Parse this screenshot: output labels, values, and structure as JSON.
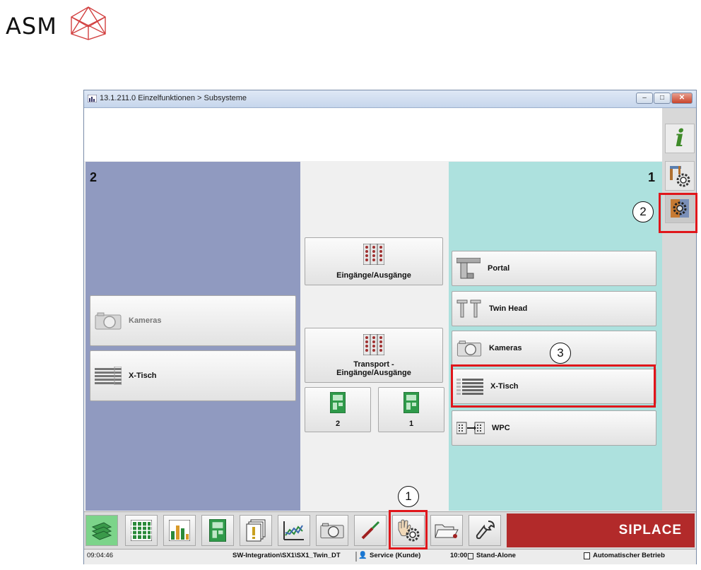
{
  "logo": {
    "text": "ASM"
  },
  "window": {
    "title": "13.1.211.0 Einzelfunktionen > Subsysteme",
    "controls": {
      "minimize": "–",
      "maximize": "□",
      "close": "✕"
    }
  },
  "panels": {
    "left": {
      "number": "2",
      "buttons": [
        {
          "label": "Kameras",
          "icon": "camera-icon",
          "enabled": false
        },
        {
          "label": "X-Tisch",
          "icon": "x-table-icon",
          "enabled": true
        }
      ]
    },
    "middle": {
      "buttons": [
        {
          "label": "Eingänge/Ausgänge",
          "icon": "io-matrix-icon"
        },
        {
          "label_line1": "Transport -",
          "label_line2": "Eingänge/Ausgänge",
          "icon": "io-matrix-icon"
        }
      ],
      "conveyors": [
        {
          "label": "2",
          "icon": "board-icon"
        },
        {
          "label": "1",
          "icon": "board-icon"
        }
      ]
    },
    "right": {
      "number": "1",
      "buttons": [
        {
          "label": "Portal",
          "icon": "portal-icon"
        },
        {
          "label": "Twin Head",
          "icon": "twin-head-icon"
        },
        {
          "label": "Kameras",
          "icon": "camera-icon"
        },
        {
          "label": "X-Tisch",
          "icon": "x-table-icon"
        },
        {
          "label": "WPC",
          "icon": "wpc-icon"
        }
      ]
    }
  },
  "rail": [
    {
      "name": "info-icon",
      "glyph": "i"
    },
    {
      "name": "machine-gear-icon"
    },
    {
      "name": "subsystems-gear-icon"
    }
  ],
  "taskbar": {
    "icons": [
      "production-icon",
      "feeder-grid-icon",
      "statistics-icon",
      "board-icon",
      "documents-icon",
      "chart-icon",
      "camera-icon",
      "tools-icon",
      "manual-functions-icon",
      "folder-icon",
      "wrench-icon"
    ],
    "brand": "SIPLACE"
  },
  "statusbar": {
    "time": "09:04:46",
    "path": "SW-Integration\\SX1\\SX1_Twin_DT",
    "user": "Service (Kunde)",
    "clock": "10:00",
    "mode": "Stand-Alone",
    "operation": "Automatischer Betrieb"
  },
  "callouts": [
    "1",
    "2",
    "3"
  ],
  "colors": {
    "left_panel": "#909ac0",
    "right_panel": "#ade1de",
    "brand_red": "#b22a2a",
    "highlight": "#e0161b"
  }
}
